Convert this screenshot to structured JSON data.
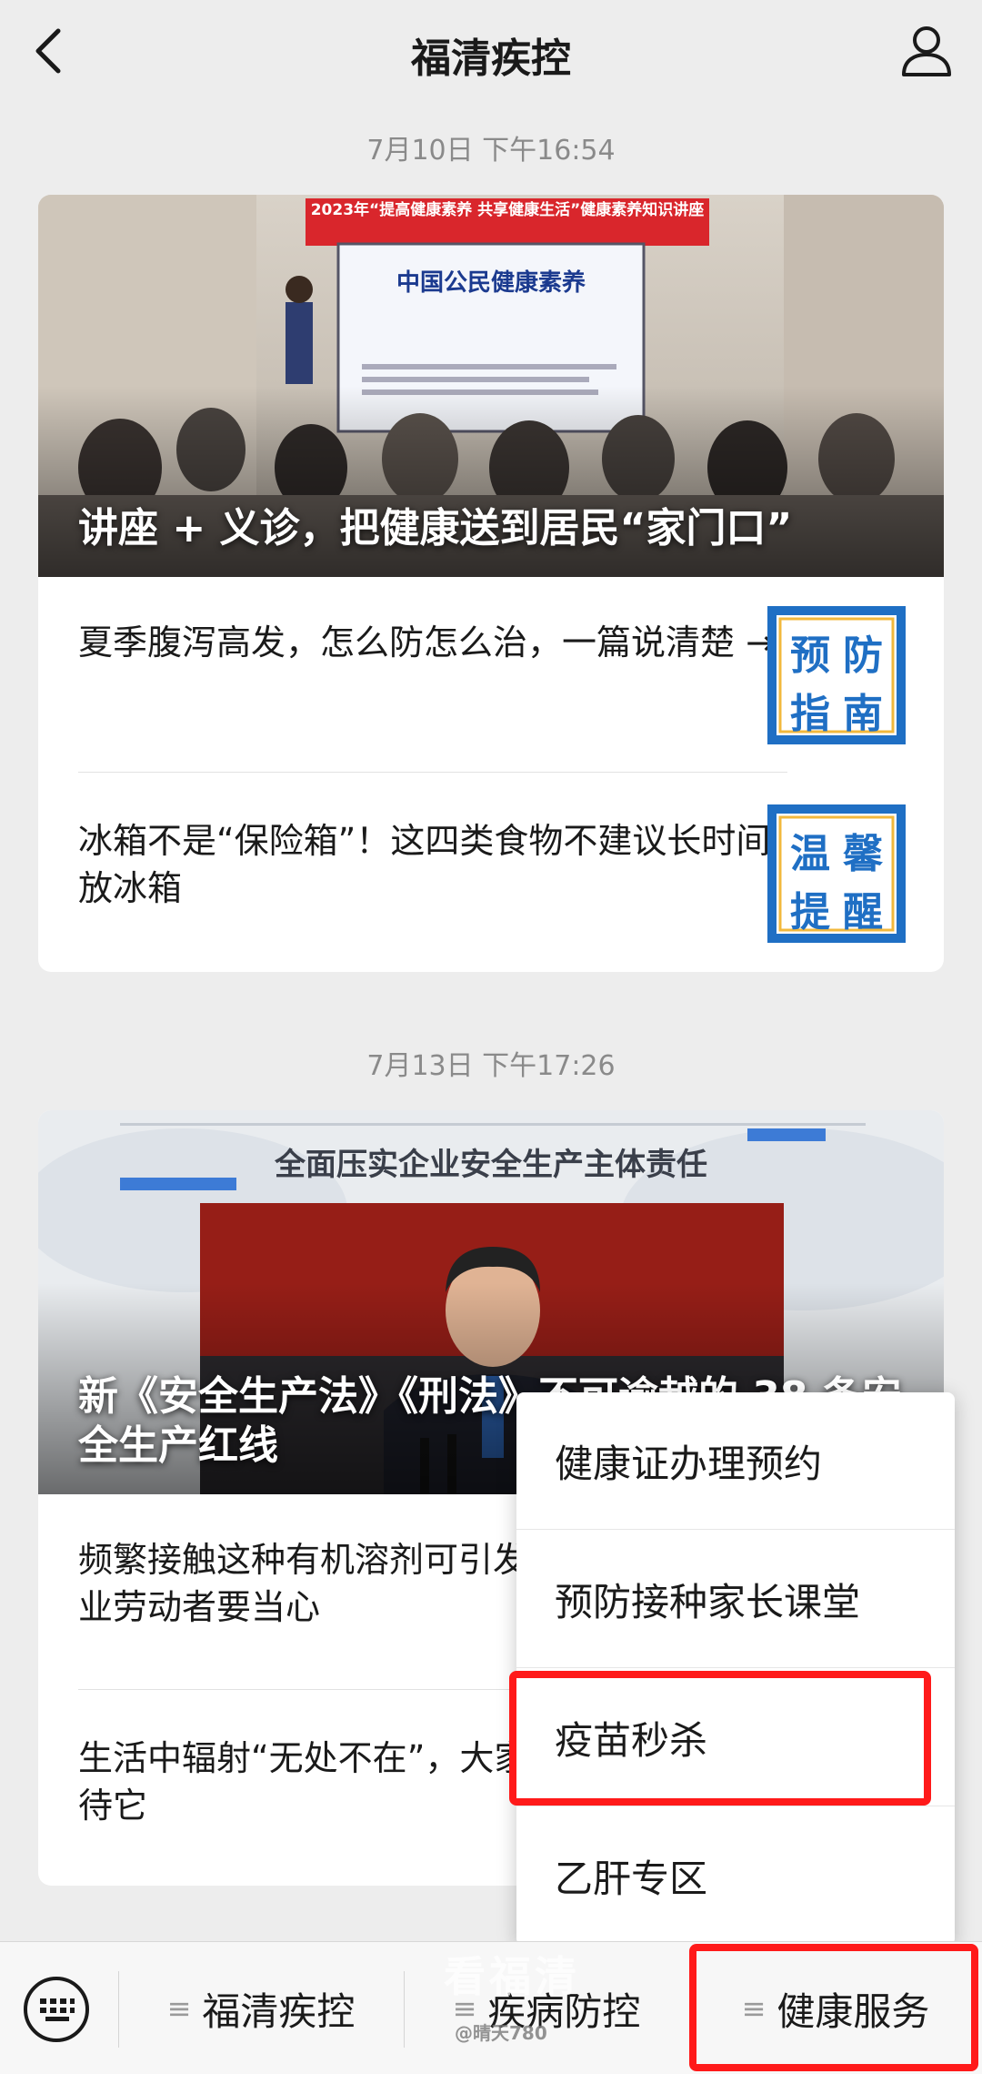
{
  "header": {
    "title": "福清疾控"
  },
  "feed": [
    {
      "timestamp": "7月10日 下午16:54",
      "hero": {
        "caption": "讲座 + 义诊，把健康送到居民“家门口”",
        "banner": "2023年“提高健康素养 共享健康生活”健康素养知识讲座",
        "screen_text": "中国公民健康素养"
      },
      "items": [
        {
          "title": "夏季腹泻高发，怎么防怎么治，一篇说清楚 →",
          "thumb": [
            "预",
            "防",
            "指",
            "南"
          ]
        },
        {
          "title": "冰箱不是“保险箱”！这四类食物不建议长时间放冰箱",
          "thumb": [
            "温",
            "馨",
            "提",
            "醒"
          ]
        }
      ]
    },
    {
      "timestamp": "7月13日 下午17:26",
      "hero": {
        "caption": "新《安全生产法》《刑法》不可逾越的 38 条安全生产红线",
        "banner": "全面压实企业安全生产主体责任"
      },
      "items": [
        {
          "title": "频繁接触这种有机溶剂可引发肝炎？这五类行业劳动者要当心"
        },
        {
          "title": "生活中辐射“无处不在”，大家应该如何正确看待它"
        }
      ]
    }
  ],
  "popup_menu": {
    "items": [
      "健康证办理预约",
      "预防接种家长课堂",
      "疫苗秒杀",
      "乙肝专区"
    ],
    "highlighted": "疫苗秒杀"
  },
  "bottom_menu": {
    "tabs": [
      "福清疾控",
      "疾病防控",
      "健康服务"
    ],
    "active": "健康服务"
  },
  "watermark": {
    "main": "看福清",
    "sub": "@晴天780"
  },
  "colors": {
    "background": "#ededed",
    "highlight": "#ff1a1a",
    "banner_red": "#d9262c",
    "thumb_blue": "#1f6fc4"
  },
  "icons": [
    "back-arrow-icon",
    "profile-icon",
    "keyboard-icon",
    "hamburger-icon"
  ]
}
